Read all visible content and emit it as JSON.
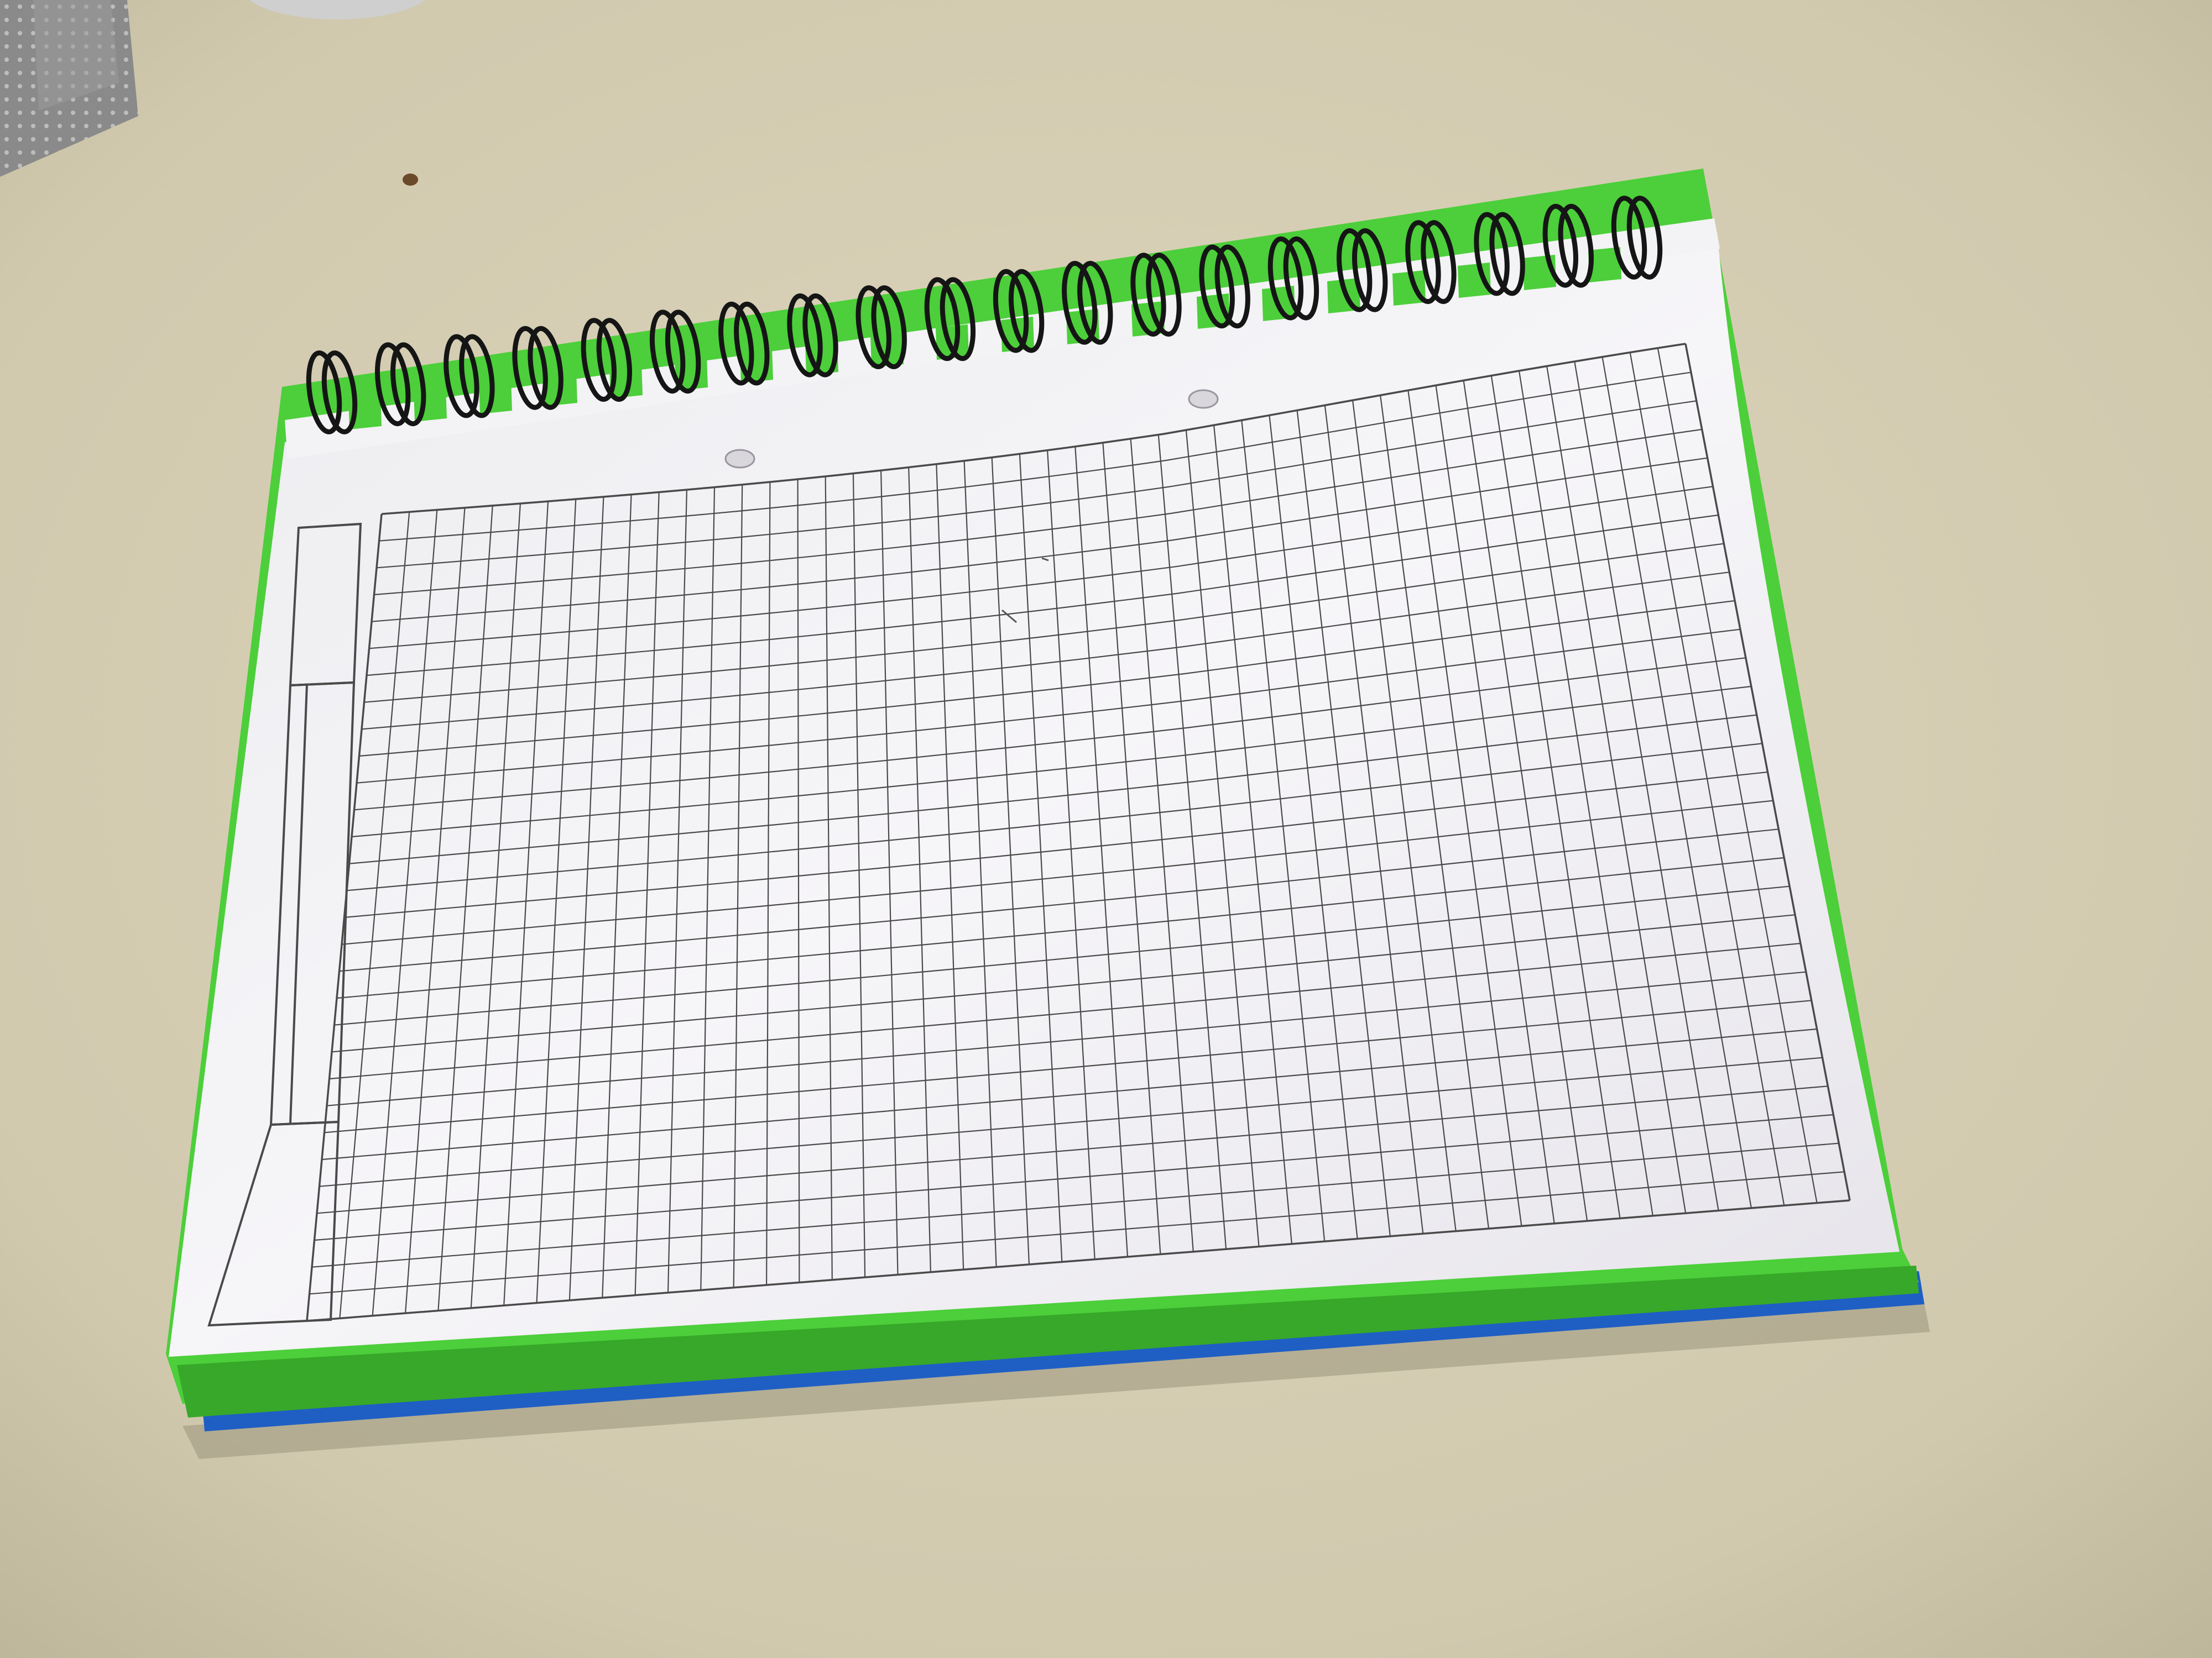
{
  "photo": {
    "subject": "notebook",
    "binding": "spiral-wire",
    "page_ruling": "square-grid",
    "grid": {
      "columns": 47,
      "rows": 30
    },
    "spiral_ring_count": 20,
    "punch_hole_count": 2
  },
  "colors": {
    "desk": "#d7d0b6",
    "desk_shadow": "#b3ab92",
    "paper": "#f4f3f6",
    "paper_shade": "#dfdde2",
    "grid_line": "#4a4a4a",
    "cover_green": "#4ccf3a",
    "cover_green_dark": "#37a82a",
    "cover_blue": "#1f5fc4",
    "wire": "#151515",
    "corner_box": "#8a8a8a"
  }
}
